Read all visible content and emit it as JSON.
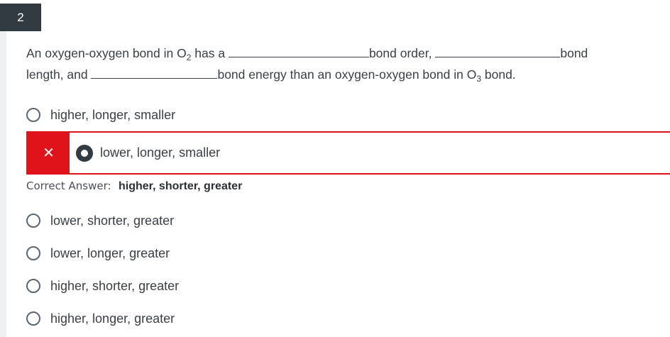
{
  "question": {
    "number": "2",
    "stem": {
      "part1": "An oxygen-oxygen bond in O",
      "sub1": "2",
      "part2": " has a ",
      "part3": "bond order, ",
      "part4": "bond",
      "part5": "length, and ",
      "part6": "bond energy than an oxygen-oxygen bond in O",
      "sub2": "3",
      "part7": " bond."
    }
  },
  "options": [
    {
      "label": "higher, longer, smaller",
      "state": "unselected"
    },
    {
      "label": "lower, longer, smaller",
      "state": "selected-incorrect"
    },
    {
      "label": "lower, shorter, greater",
      "state": "unselected"
    },
    {
      "label": "lower, longer, greater",
      "state": "unselected"
    },
    {
      "label": "higher, shorter, greater",
      "state": "unselected"
    },
    {
      "label": "higher, longer, greater",
      "state": "unselected"
    }
  ],
  "feedback": {
    "incorrect_icon": "close-icon",
    "incorrect_glyph": "✕",
    "correct_label": "Correct Answer:",
    "correct_answer": "higher, shorter, greater"
  },
  "colors": {
    "incorrect": "#e0121a",
    "badge": "#333b42",
    "text": "#3a3f44"
  }
}
